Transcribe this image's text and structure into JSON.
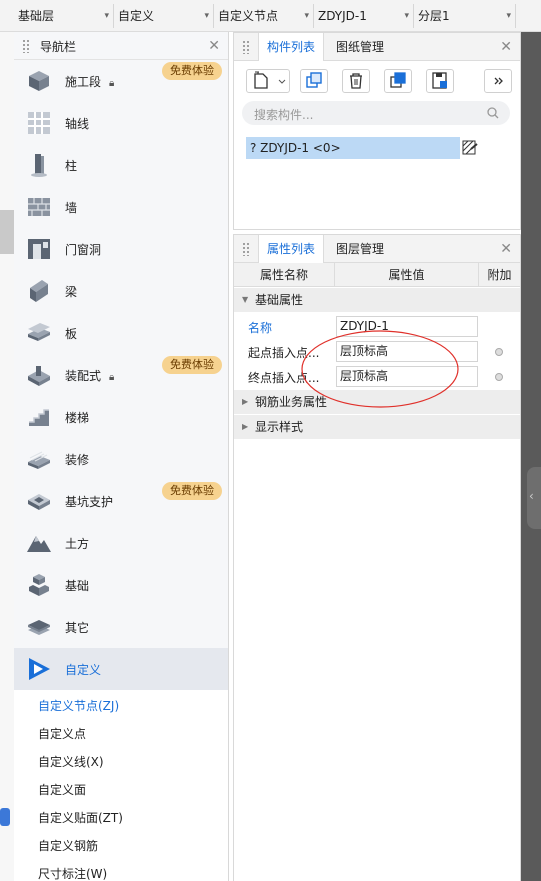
{
  "toolbar": {
    "dropdowns": [
      {
        "label": "基础层"
      },
      {
        "label": "自定义"
      },
      {
        "label": "自定义节点"
      },
      {
        "label": "ZDYJD-1"
      },
      {
        "label": "分层1"
      }
    ]
  },
  "nav": {
    "title": "导航栏",
    "badge_label": "免费体验",
    "items": [
      {
        "label": "施工段",
        "icon": "construction-stage-icon",
        "locked": true,
        "badge": true
      },
      {
        "label": "轴线",
        "icon": "axis-grid-icon"
      },
      {
        "label": "柱",
        "icon": "column-icon"
      },
      {
        "label": "墙",
        "icon": "wall-icon"
      },
      {
        "label": "门窗洞",
        "icon": "door-window-icon"
      },
      {
        "label": "梁",
        "icon": "beam-icon"
      },
      {
        "label": "板",
        "icon": "slab-icon"
      },
      {
        "label": "装配式",
        "icon": "prefab-icon",
        "locked": true,
        "badge": true
      },
      {
        "label": "楼梯",
        "icon": "stairs-icon"
      },
      {
        "label": "装修",
        "icon": "decoration-icon"
      },
      {
        "label": "基坑支护",
        "icon": "foundation-pit-icon",
        "badge": true
      },
      {
        "label": "土方",
        "icon": "earthwork-icon"
      },
      {
        "label": "基础",
        "icon": "foundation-icon"
      },
      {
        "label": "其它",
        "icon": "other-icon"
      },
      {
        "label": "自定义",
        "icon": "custom-icon",
        "selected": true
      }
    ],
    "sub_items": [
      {
        "label": "自定义节点(ZJ)",
        "active": true
      },
      {
        "label": "自定义点"
      },
      {
        "label": "自定义线(X)"
      },
      {
        "label": "自定义面"
      },
      {
        "label": "自定义贴面(ZT)"
      },
      {
        "label": "自定义钢筋"
      },
      {
        "label": "尺寸标注(W)"
      }
    ]
  },
  "component_panel": {
    "tabs": [
      "构件列表",
      "图纸管理"
    ],
    "search_placeholder": "搜索构件...",
    "component": "? ZDYJD-1 <0>"
  },
  "property_panel": {
    "tabs": [
      "属性列表",
      "图层管理"
    ],
    "headers": [
      "属性名称",
      "属性值",
      "附加"
    ],
    "group_basic": "基础属性",
    "rows": [
      {
        "name": "名称",
        "value": "ZDYJD-1"
      },
      {
        "name": "起点插入点...",
        "value": "层顶标高"
      },
      {
        "name": "终点插入点...",
        "value": "层顶标高"
      }
    ],
    "group_rebar": "钢筋业务属性",
    "group_display": "显示样式"
  },
  "colors": {
    "accent": "#1a6fd8",
    "badge": "#f6d28f",
    "annotation": "#e0302a"
  }
}
